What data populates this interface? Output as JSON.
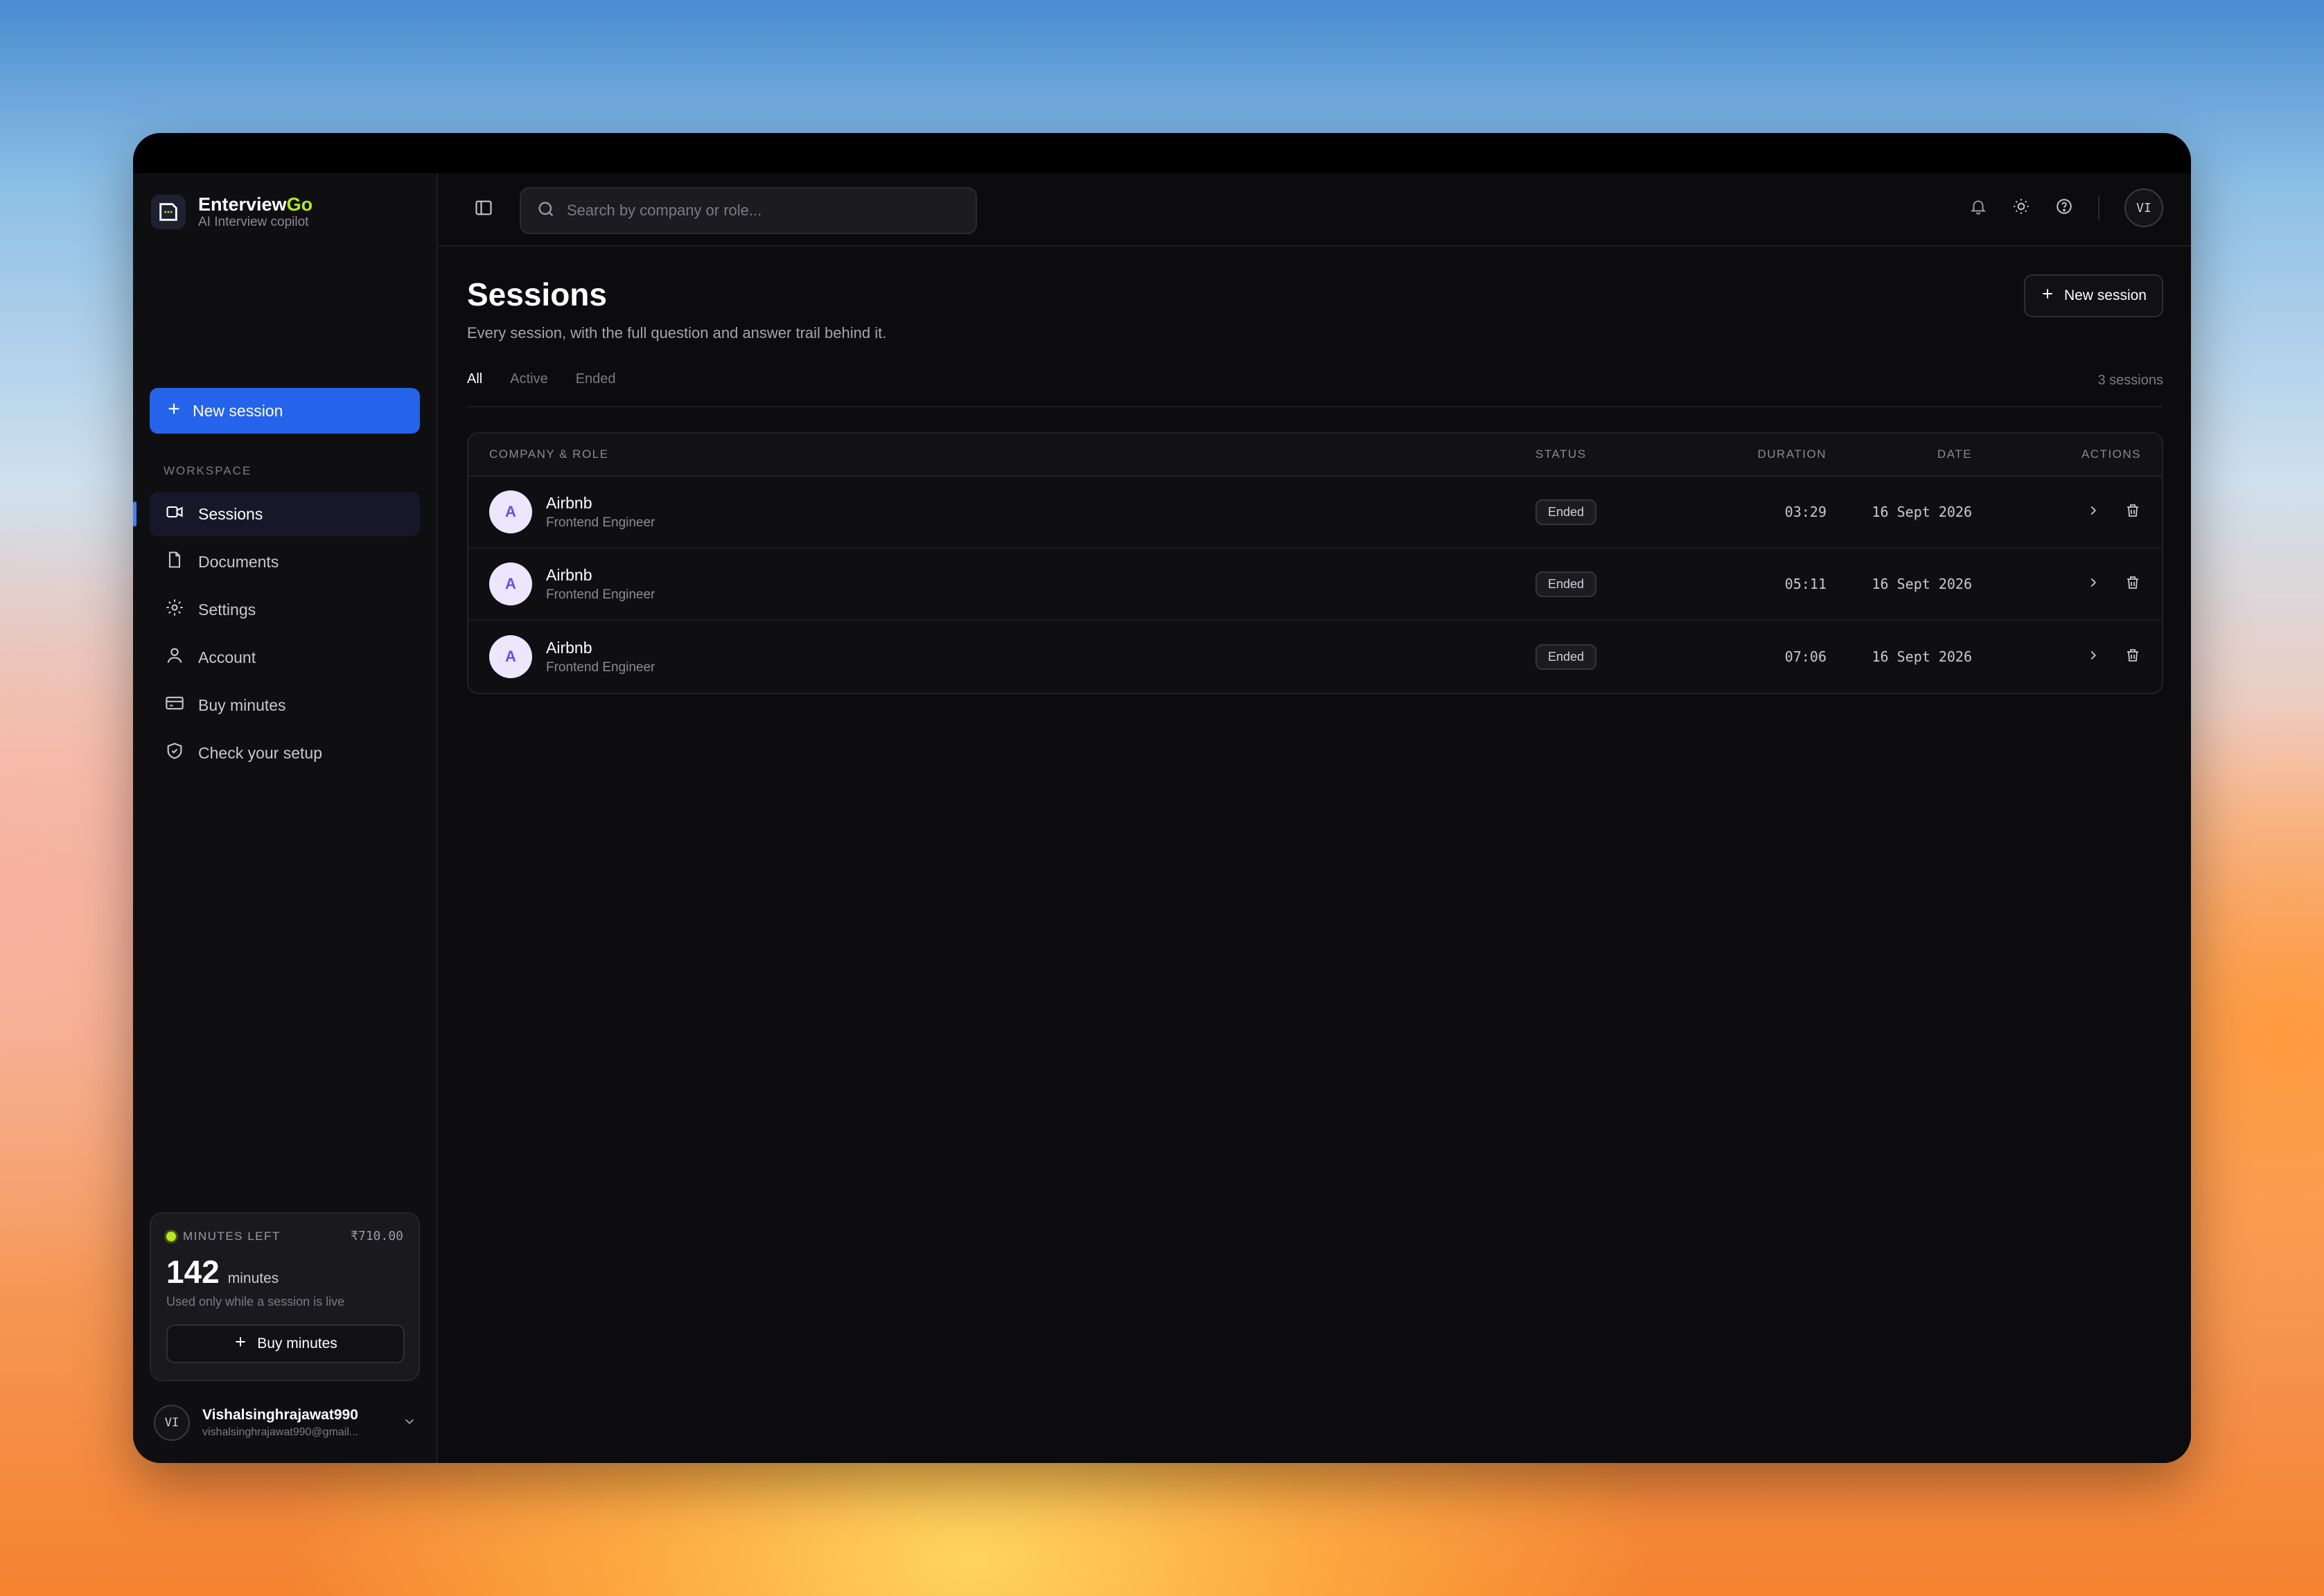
{
  "brand": {
    "name_main": "Enterview",
    "name_accent": "Go",
    "subtitle": "AI Interview copilot"
  },
  "sidebar": {
    "new_session_label": "New session",
    "section_label": "WORKSPACE",
    "items": [
      {
        "label": "Sessions",
        "icon": "video-icon"
      },
      {
        "label": "Documents",
        "icon": "document-icon"
      },
      {
        "label": "Settings",
        "icon": "gear-icon"
      },
      {
        "label": "Account",
        "icon": "user-icon"
      },
      {
        "label": "Buy minutes",
        "icon": "card-icon"
      },
      {
        "label": "Check your setup",
        "icon": "shield-icon"
      }
    ],
    "minutes": {
      "label": "MINUTES LEFT",
      "price": "₹710.00",
      "value": "142",
      "unit": "minutes",
      "note": "Used only while a session is live",
      "button_label": "Buy minutes"
    },
    "user": {
      "initials": "VI",
      "name": "Vishalsinghrajawat990",
      "email": "vishalsinghrajawat990@gmail..."
    }
  },
  "header": {
    "search_placeholder": "Search by company or role...",
    "avatar_initials": "VI"
  },
  "page": {
    "title": "Sessions",
    "subtitle": "Every session, with the full question and answer trail behind it.",
    "new_session_label": "New session",
    "tabs": [
      "All",
      "Active",
      "Ended"
    ],
    "active_tab": "All",
    "count": "3 sessions"
  },
  "table": {
    "headers": {
      "company": "COMPANY & ROLE",
      "status": "STATUS",
      "duration": "DURATION",
      "date": "DATE",
      "actions": "ACTIONS"
    },
    "rows": [
      {
        "initial": "A",
        "company": "Airbnb",
        "role": "Frontend Engineer",
        "status": "Ended",
        "duration": "03:29",
        "date": "16 Sept 2026"
      },
      {
        "initial": "A",
        "company": "Airbnb",
        "role": "Frontend Engineer",
        "status": "Ended",
        "duration": "05:11",
        "date": "16 Sept 2026"
      },
      {
        "initial": "A",
        "company": "Airbnb",
        "role": "Frontend Engineer",
        "status": "Ended",
        "duration": "07:06",
        "date": "16 Sept 2026"
      }
    ]
  },
  "colors": {
    "accent": "#2563eb",
    "brand_accent": "#b6e81e",
    "background": "#0c0c0e"
  }
}
